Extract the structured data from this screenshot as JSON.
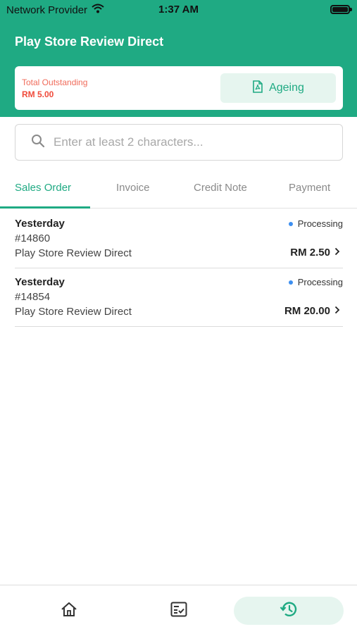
{
  "status_bar": {
    "carrier": "Network Provider",
    "time": "1:37 AM"
  },
  "header": {
    "title": "Play Store Review Direct"
  },
  "summary": {
    "label": "Total Outstanding",
    "value": "RM 5.00",
    "ageing_label": "Ageing"
  },
  "search": {
    "placeholder": "Enter at least 2 characters..."
  },
  "tabs": [
    {
      "label": "Sales Order",
      "active": true
    },
    {
      "label": "Invoice",
      "active": false
    },
    {
      "label": "Credit Note",
      "active": false
    },
    {
      "label": "Payment",
      "active": false
    }
  ],
  "orders": [
    {
      "date": "Yesterday",
      "number": "#14860",
      "customer": "Play Store Review Direct",
      "status": "Processing",
      "amount": "RM 2.50"
    },
    {
      "date": "Yesterday",
      "number": "#14854",
      "customer": "Play Store Review Direct",
      "status": "Processing",
      "amount": "RM 20.00"
    }
  ],
  "bottom_nav": [
    {
      "icon": "home-icon",
      "active": false
    },
    {
      "icon": "checklist-icon",
      "active": false
    },
    {
      "icon": "history-icon",
      "active": true
    }
  ],
  "colors": {
    "brand": "#1faa83",
    "outstanding": "#f04a3a",
    "status_dot": "#3d8ff0"
  }
}
